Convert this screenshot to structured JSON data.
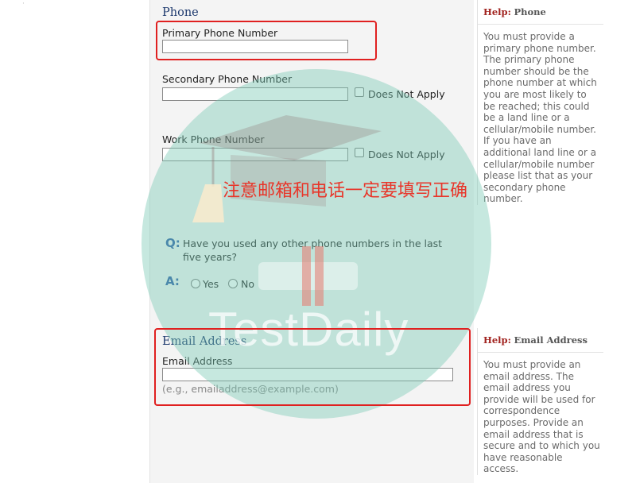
{
  "phone": {
    "section_title": "Phone",
    "primary_label": "Primary Phone Number",
    "primary_value": "",
    "secondary_label": "Secondary Phone Number",
    "secondary_value": "",
    "work_label": "Work Phone Number",
    "work_value": "",
    "does_not_apply": "Does Not Apply",
    "question": "Have you used any other phone numbers in the last five years?",
    "q_marker": "Q:",
    "a_marker": "A:",
    "yes": "Yes",
    "no": "No"
  },
  "email": {
    "section_title": "Email Address",
    "label": "Email Address",
    "value": "",
    "example": "(e.g., emailaddress@example.com)"
  },
  "help_phone": {
    "prefix": "Help:",
    "topic": "Phone",
    "body": "You must provide a primary phone number. The primary phone number should be the phone number at which you are most likely to be reached; this could be a land line or a cellular/mobile number. If you have an additional land line or a cellular/mobile number please list that as your secondary phone number."
  },
  "help_email": {
    "prefix": "Help:",
    "topic": "Email Address",
    "body": "You must provide an email address.  The email address you provide will be used for correspondence purposes.  Provide an email address that is secure and to which you have reasonable access."
  },
  "overlay": {
    "watermark": "TestDaily",
    "annotation": "注意邮箱和电话一定要填写正确"
  },
  "colors": {
    "watermark": "#76c9b2",
    "annotation": "#e8362a",
    "highlight_box": "#e02020",
    "section_title": "#1e3a6e",
    "help_prefix": "#a1221e"
  }
}
